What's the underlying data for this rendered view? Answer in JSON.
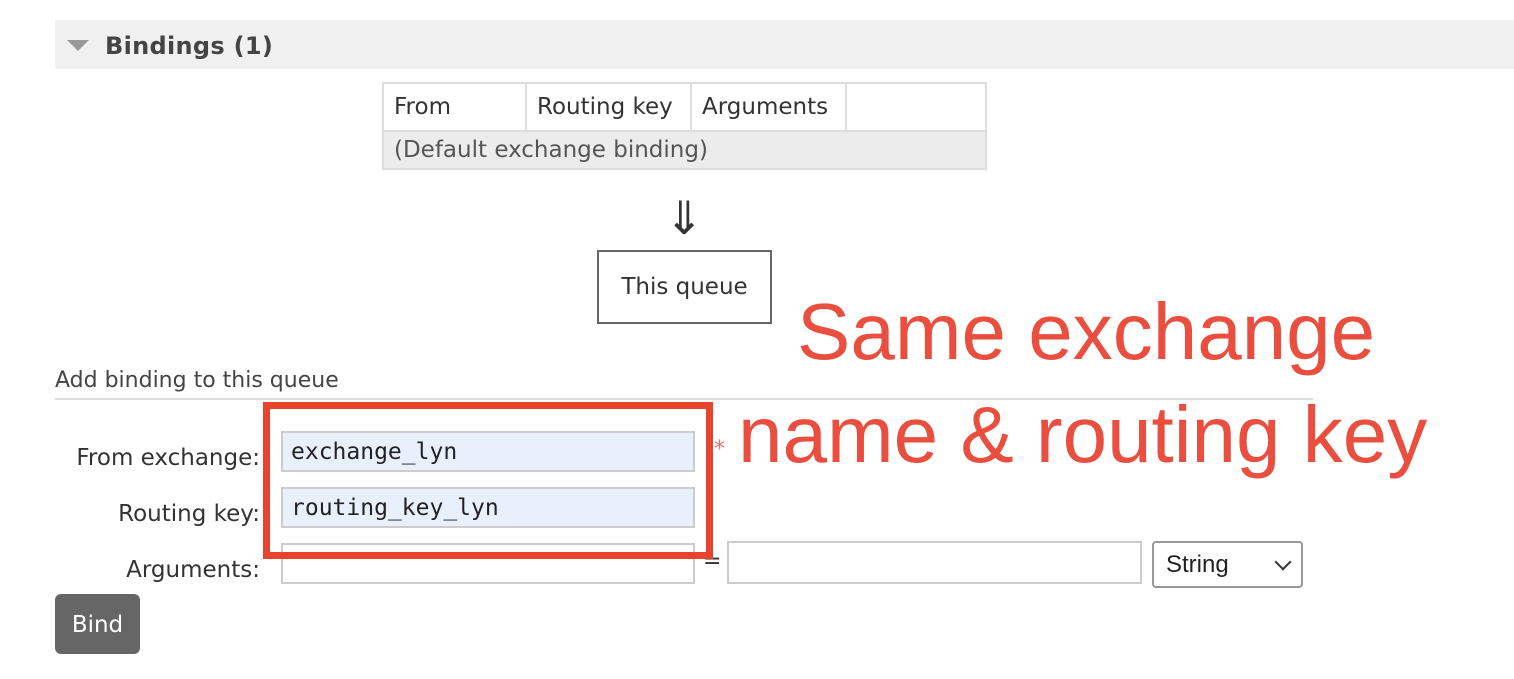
{
  "section": {
    "title": "Bindings (1)"
  },
  "bindings_table": {
    "headers": [
      "From",
      "Routing key",
      "Arguments",
      ""
    ],
    "rows": [
      {
        "from": "(Default exchange binding)"
      }
    ]
  },
  "flow": {
    "arrow_glyph": "⇓",
    "queue_label": "This queue"
  },
  "add_binding": {
    "title": "Add binding to this queue",
    "from_exchange_label": "From exchange:",
    "from_exchange_value": "exchange_lyn",
    "required_marker": "*",
    "routing_key_label": "Routing key:",
    "routing_key_value": "routing_key_lyn",
    "arguments_label": "Arguments:",
    "arguments_key_value": "",
    "equals": "=",
    "arguments_value": "",
    "type_selected": "String",
    "bind_button": "Bind"
  },
  "annotation": {
    "line1": "Same exchange",
    "line2": "name & routing key",
    "color": "#e94e3f",
    "box_color": "#e8432d"
  }
}
